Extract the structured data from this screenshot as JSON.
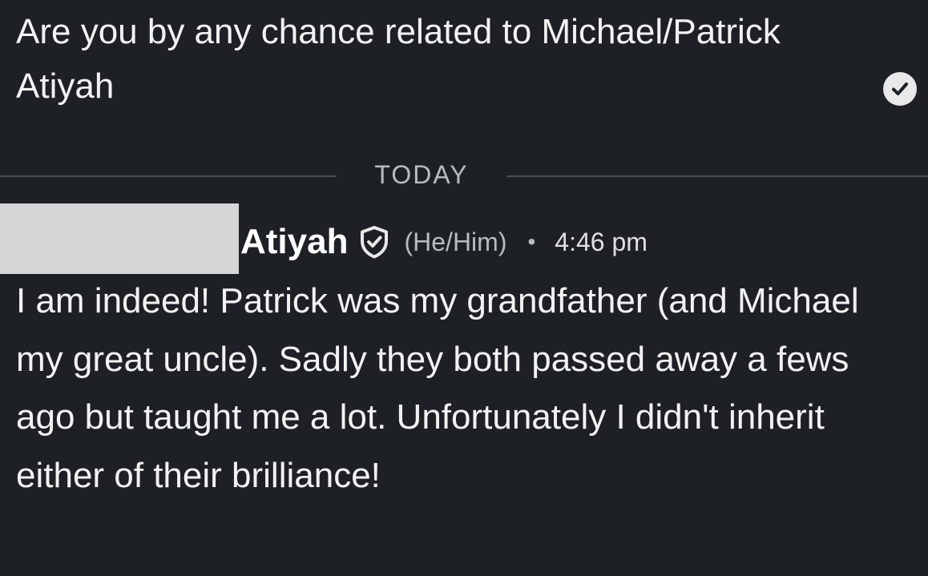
{
  "previous_message": {
    "text": "Are you by any chance related to Michael/Patrick Atiyah",
    "status_icon": "checkmark-circle-icon"
  },
  "divider": {
    "label": "TODAY"
  },
  "reply": {
    "sender_name": "Atiyah",
    "badge_icon": "shield-check-icon",
    "pronouns": "(He/Him)",
    "separator": "•",
    "time": "4:46 pm",
    "text": "I am indeed! Patrick was my grandfather (and Michael my great uncle). Sadly they both passed away a fews ago but taught me a lot. Unfortunately I didn't inherit either of their brilliance!"
  },
  "colors": {
    "background": "#1d2125",
    "text": "#f2f2f2",
    "muted": "#b8bcc0",
    "divider_line": "#4a4f55",
    "redaction": "#d6d6d6"
  }
}
